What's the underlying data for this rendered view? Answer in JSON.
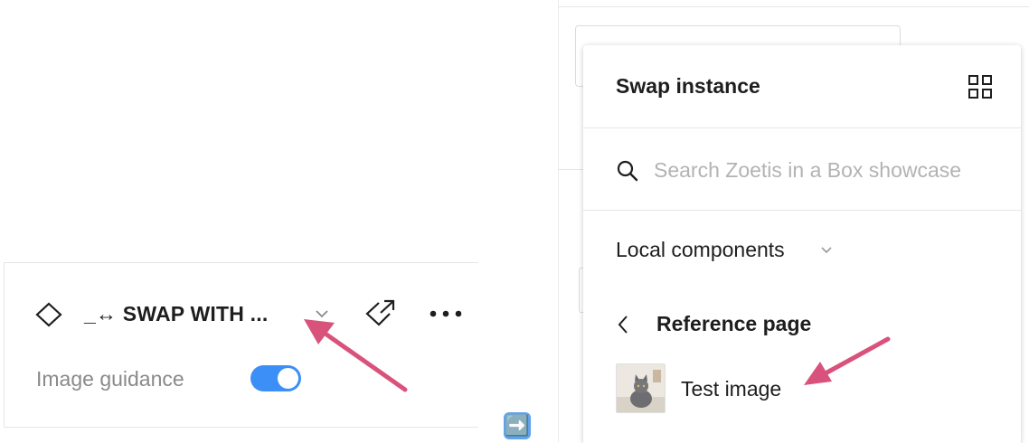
{
  "left_panel": {
    "component_name": "_↔ SWAP WITH ...",
    "guidance_label": "Image guidance",
    "guidance_enabled": true,
    "icons": {
      "component": "component-diamond-icon",
      "dropdown": "chevron-down-icon",
      "go_to_main": "go-to-main-component-icon",
      "more": "more-horizontal-icon"
    }
  },
  "transition_emoji": "➡️",
  "swap_panel": {
    "title": "Swap instance",
    "search_placeholder": "Search Zoetis in a Box showcase",
    "library_label": "Local components",
    "page_label": "Reference page",
    "item_label": "Test image",
    "icons": {
      "view_toggle": "grid-icon",
      "search": "search-icon",
      "library_dropdown": "chevron-down-icon",
      "back": "chevron-left-icon",
      "thumbnail": "cat-image-thumbnail"
    }
  },
  "colors": {
    "toggle_on": "#3b8ff6",
    "annotation_arrow": "#d9527c",
    "placeholder_text": "#b3b3b3",
    "muted_label": "#8a8a8a"
  }
}
